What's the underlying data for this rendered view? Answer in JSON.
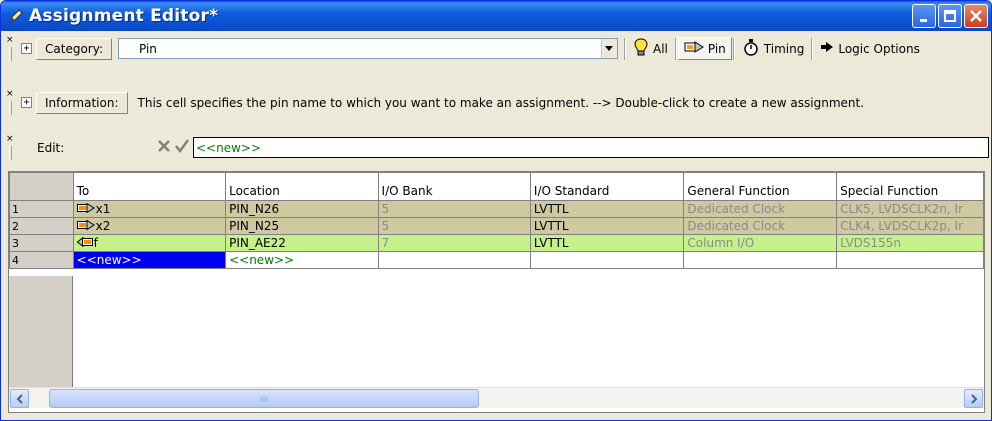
{
  "window": {
    "title": "Assignment Editor*"
  },
  "category": {
    "label": "Category:",
    "value": "Pin",
    "buttons": [
      {
        "label": "All",
        "icon": "bulb-icon"
      },
      {
        "label": "Pin",
        "icon": "pin-icon",
        "active": true
      },
      {
        "label": "Timing",
        "icon": "stopwatch-icon"
      },
      {
        "label": "Logic Options",
        "icon": "arrow-right-icon"
      }
    ]
  },
  "information": {
    "label": "Information:",
    "text": "This cell specifies the pin name to which you want to make an assignment.   --> Double-click to create a new assignment."
  },
  "edit": {
    "label": "Edit:",
    "value": "<<new>>"
  },
  "grid": {
    "columns": [
      "To",
      "Location",
      "I/O Bank",
      "I/O Standard",
      "General Function",
      "Special Function"
    ],
    "rows": [
      {
        "num": "1",
        "to": "x1",
        "location": "PIN_N26",
        "bank": "5",
        "standard": "LVTTL",
        "general": "Dedicated Clock",
        "special": "CLK5, LVDSCLK2n, Ir"
      },
      {
        "num": "2",
        "to": "x2",
        "location": "PIN_N25",
        "bank": "5",
        "standard": "LVTTL",
        "general": "Dedicated Clock",
        "special": "CLK4, LVDSCLK2p, Ir"
      },
      {
        "num": "3",
        "to": "f",
        "location": "PIN_AE22",
        "bank": "7",
        "standard": "LVTTL",
        "general": "Column I/O",
        "special": "LVDS155n"
      },
      {
        "num": "4",
        "to": "<<new>>",
        "location": "<<new>>",
        "bank": "",
        "standard": "",
        "general": "",
        "special": ""
      }
    ]
  },
  "colors": {
    "title_bar": "#0a52d6",
    "row_input": "#cfc9a1",
    "row_output": "#c6f08a",
    "selection": "#0000f0",
    "new_text": "#008000"
  }
}
